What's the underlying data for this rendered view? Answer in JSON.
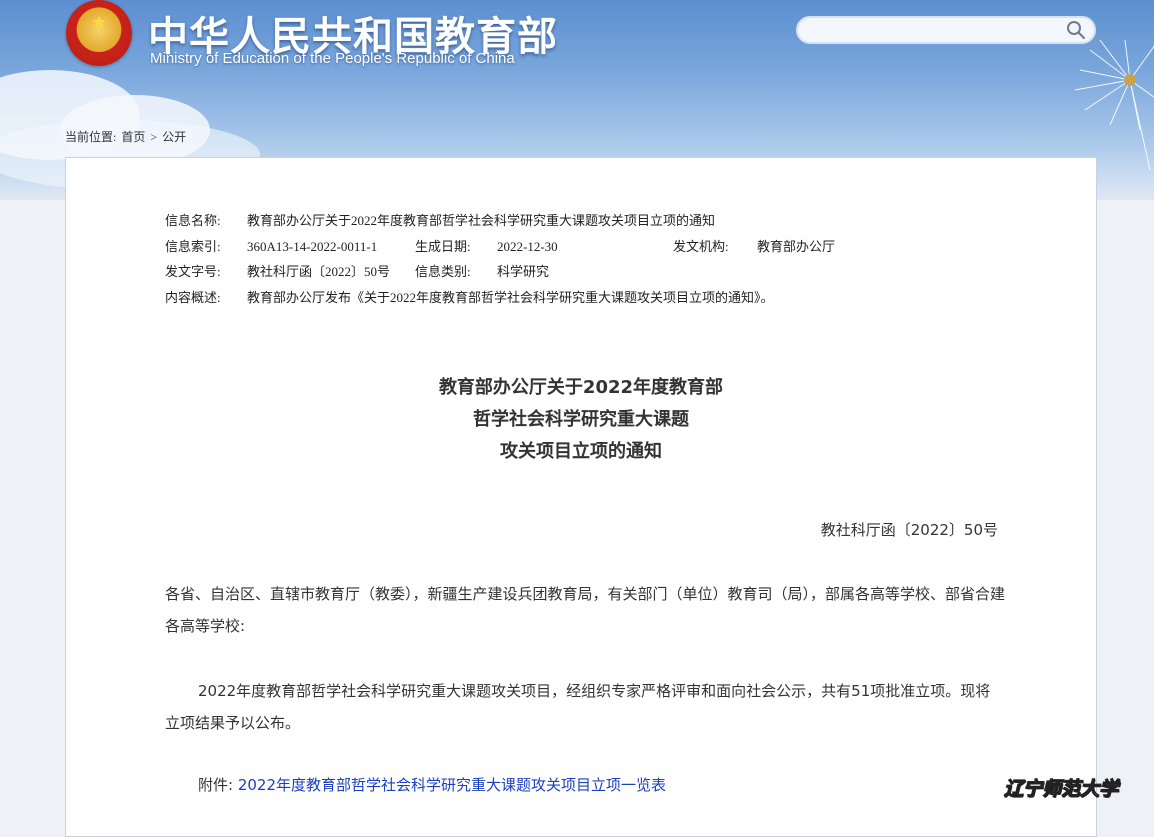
{
  "header": {
    "title": "中华人民共和国教育部",
    "subtitle": "Ministry of Education of the People's Republic of China",
    "search_placeholder": ""
  },
  "breadcrumb": {
    "prefix": "当前位置:",
    "home": "首页",
    "separator": ">",
    "current": "公开"
  },
  "meta": {
    "name_label": "信息名称:",
    "name_value": "教育部办公厅关于2022年度教育部哲学社会科学研究重大课题攻关项目立项的通知",
    "index_label": "信息索引:",
    "index_value": "360A13-14-2022-0011-1",
    "date_label": "生成日期:",
    "date_value": "2022-12-30",
    "issuer_label": "发文机构:",
    "issuer_value": "教育部办公厅",
    "docno_label": "发文字号:",
    "docno_value": "教社科厅函〔2022〕50号",
    "category_label": "信息类别:",
    "category_value": "科学研究",
    "summary_label": "内容概述:",
    "summary_value": "教育部办公厅发布《关于2022年度教育部哲学社会科学研究重大课题攻关项目立项的通知》。"
  },
  "document": {
    "title_line1": "教育部办公厅关于2022年度教育部",
    "title_line2": "哲学社会科学研究重大课题",
    "title_line3": "攻关项目立项的通知",
    "number": "教社科厅函〔2022〕50号",
    "addressees": "各省、自治区、直辖市教育厅（教委），新疆生产建设兵团教育局，有关部门（单位）教育司（局），部属各高等学校、部省合建各高等学校:",
    "body": "2022年度教育部哲学社会科学研究重大课题攻关项目，经组织专家严格评审和面向社会公示，共有51项批准立项。现将立项结果予以公布。",
    "attachment_label": "附件:",
    "attachment_link": "2022年度教育部哲学社会科学研究重大课题攻关项目立项一览表"
  },
  "watermark": "辽宁师范大学",
  "colors": {
    "link": "#1a3fbf",
    "banner_top": "#5d8fd0"
  }
}
